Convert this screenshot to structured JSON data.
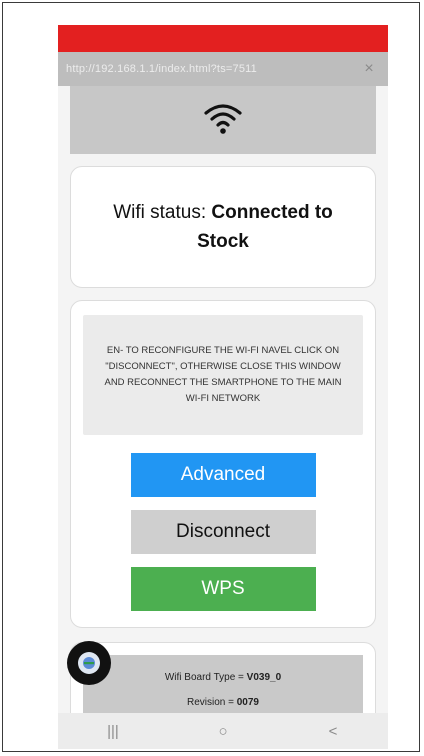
{
  "browser": {
    "url": "http://192.168.1.1/index.html?ts=7511",
    "close_glyph": "×"
  },
  "status_card": {
    "label": "Wifi status: ",
    "value": "Connected to Stock"
  },
  "notice": {
    "text": "EN- TO RECONFIGURE THE WI-FI NAVEL CLICK ON \"DISCONNECT\", OTHERWISE CLOSE THIS WINDOW AND RECONNECT THE SMARTPHONE TO THE MAIN WI-FI NETWORK"
  },
  "buttons": {
    "advanced": "Advanced",
    "disconnect": "Disconnect",
    "wps": "WPS"
  },
  "board": {
    "type_label": "Wifi Board Type = ",
    "type_value": "V039_0",
    "revision_label": "Revision = ",
    "revision_value": "0079"
  },
  "nav": {
    "recents": "|||",
    "home": "○",
    "back": "<"
  },
  "colors": {
    "status_bar": "#e32020",
    "advanced": "#2196f3",
    "disconnect": "#cfcfcf",
    "wps": "#4caf50"
  },
  "icons": {
    "header": "wifi-icon",
    "fab": "floating-app-icon"
  }
}
